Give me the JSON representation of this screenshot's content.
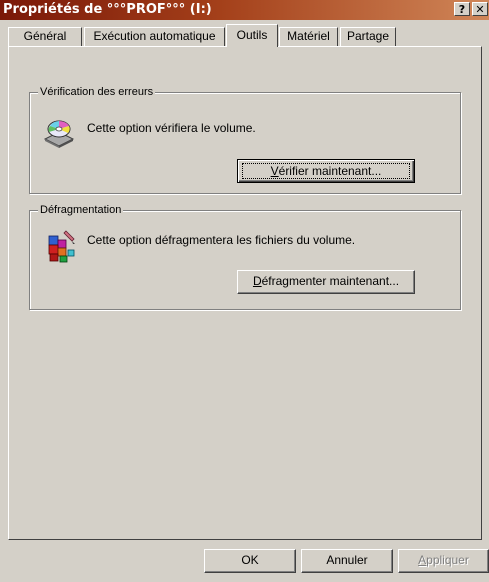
{
  "window": {
    "title": "Propriétés de °°°PROF°°° (I:)",
    "help_button": "?",
    "close_button": "✕"
  },
  "tabs": [
    {
      "label": "Général"
    },
    {
      "label": "Exécution automatique"
    },
    {
      "label": "Outils"
    },
    {
      "label": "Matériel"
    },
    {
      "label": "Partage"
    }
  ],
  "active_tab": "Outils",
  "error_check": {
    "group_label": "Vérification des erreurs",
    "description": "Cette option vérifiera le volume.",
    "button_accel": "V",
    "button_rest": "érifier maintenant...",
    "icon": "disk-check-icon"
  },
  "defrag": {
    "group_label": "Défragmentation",
    "description": "Cette option défragmentera les fichiers du volume.",
    "button_accel": "D",
    "button_rest": "éfragmenter maintenant...",
    "icon": "defrag-blocks-icon"
  },
  "buttons": {
    "ok": "OK",
    "cancel": "Annuler",
    "apply_accel": "A",
    "apply_rest": "ppliquer"
  },
  "colors": {
    "title_gradient_start": "#7a1808",
    "title_gradient_end": "#d08658",
    "face": "#d4d0c8"
  }
}
